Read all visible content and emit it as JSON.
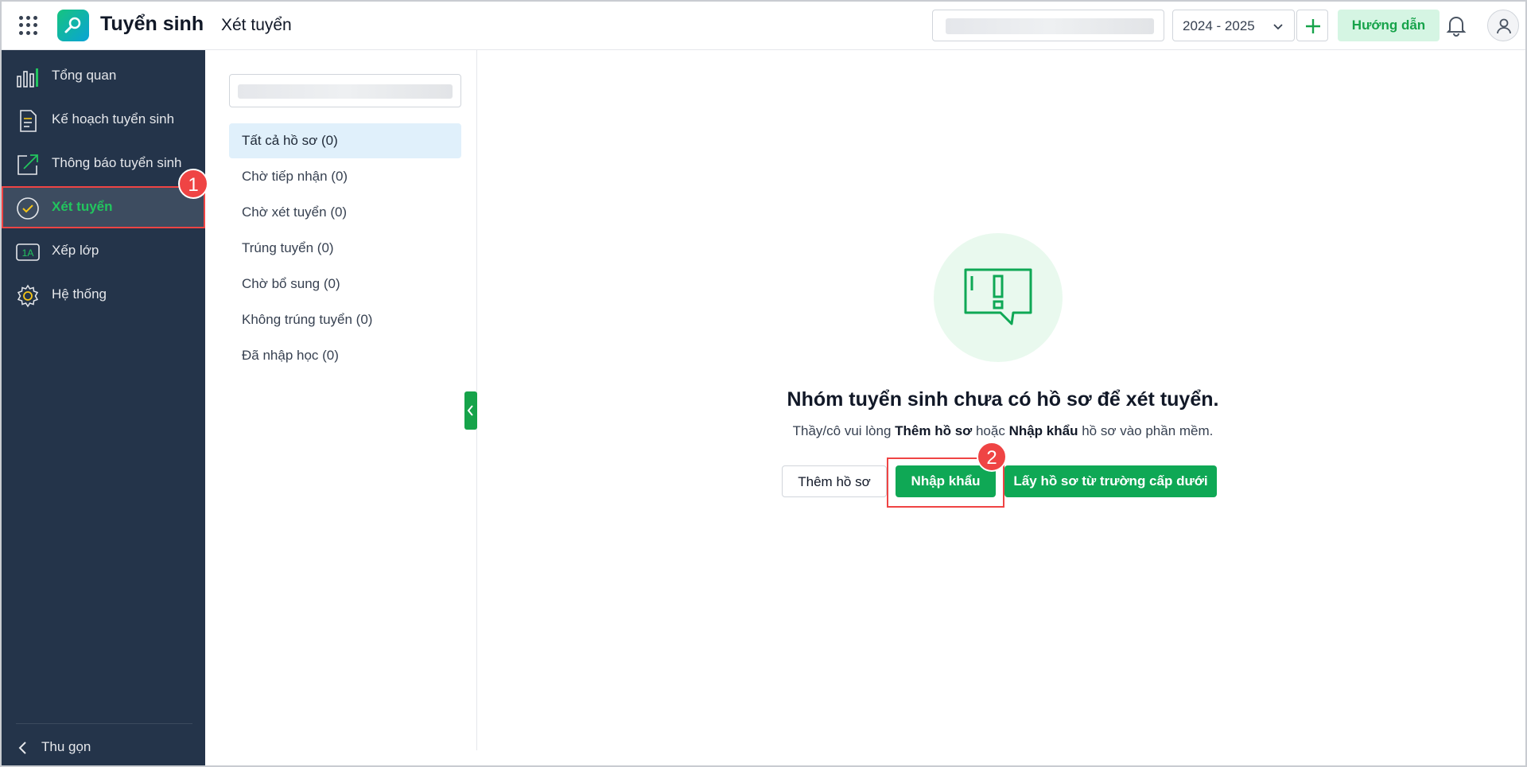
{
  "header": {
    "app_title": "Tuyển sinh",
    "page_title": "Xét tuyển",
    "year": "2024 - 2025",
    "guide_label": "Hướng dẫn"
  },
  "sidebar": {
    "items": [
      {
        "label": "Tổng quan",
        "icon": "chart-icon"
      },
      {
        "label": "Kế hoạch tuyển sinh",
        "icon": "document-icon"
      },
      {
        "label": "Thông báo tuyển sinh",
        "icon": "external-link-icon"
      },
      {
        "label": "Xét tuyển",
        "icon": "check-circle-icon",
        "active": true
      },
      {
        "label": "Xếp lớp",
        "icon": "class-1a-icon"
      },
      {
        "label": "Hệ thống",
        "icon": "gear-icon"
      }
    ],
    "collapse_label": "Thu gọn",
    "class_icon_text": "1A"
  },
  "annotations": {
    "step1": "1",
    "step2": "2"
  },
  "filters": {
    "items": [
      {
        "label": "Tất cả hồ sơ (0)",
        "selected": true
      },
      {
        "label": "Chờ tiếp nhận (0)"
      },
      {
        "label": "Chờ xét tuyển (0)"
      },
      {
        "label": "Trúng tuyển (0)"
      },
      {
        "label": "Chờ bổ sung (0)"
      },
      {
        "label": "Không trúng tuyển (0)"
      },
      {
        "label": "Đã nhập học (0)"
      }
    ]
  },
  "empty_state": {
    "title": "Nhóm tuyển sinh chưa có hồ sơ để xét tuyển.",
    "sub_prefix": "Thầy/cô vui lòng ",
    "sub_bold1": "Thêm hồ sơ",
    "sub_mid": " hoặc ",
    "sub_bold2": "Nhập khẩu",
    "sub_suffix": " hồ sơ vào phần mềm.",
    "add_label": "Thêm hồ sơ",
    "import_label": "Nhập khẩu",
    "fetch_label": "Lấy hồ sơ từ trường cấp dưới"
  },
  "colors": {
    "accent": "#0fa855",
    "sidebar_bg": "#24344a",
    "annotation": "#ef4444"
  }
}
